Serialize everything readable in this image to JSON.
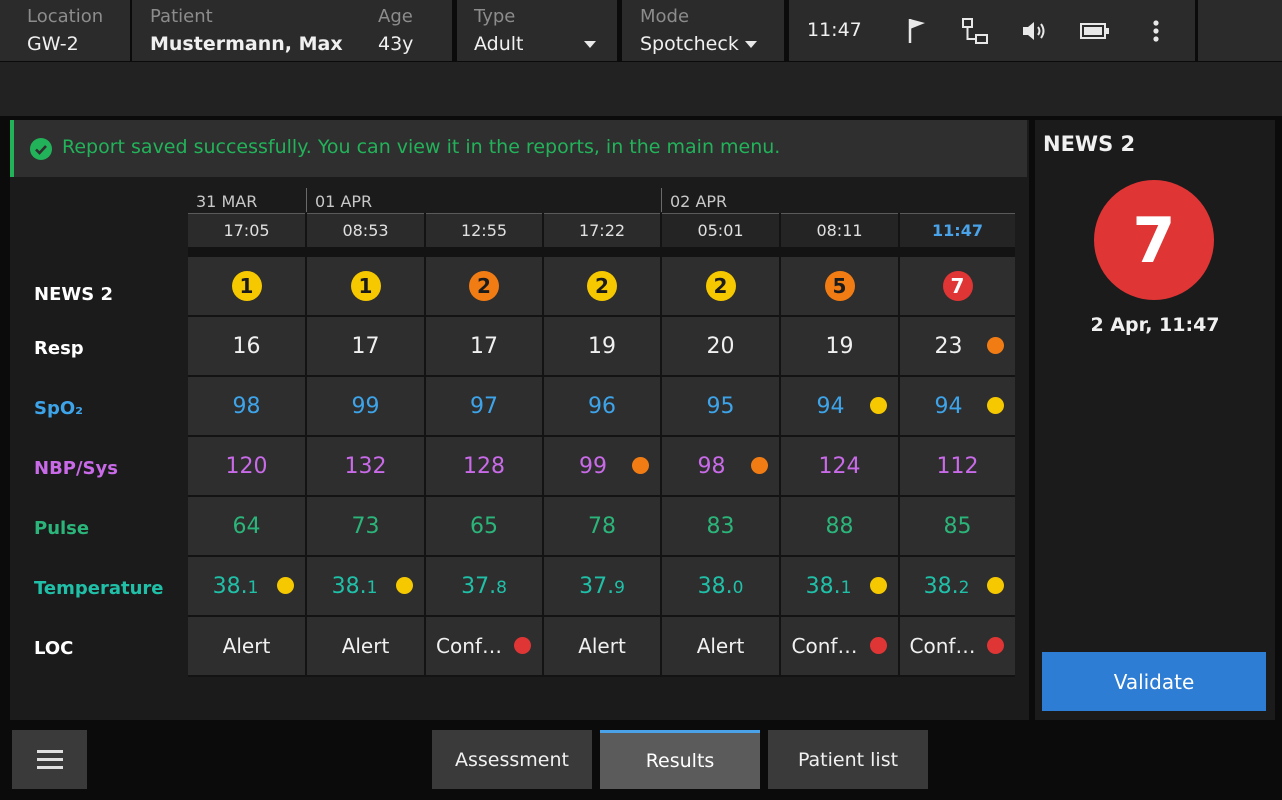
{
  "header": {
    "location_label": "Location",
    "location_value": "GW-2",
    "patient_label": "Patient",
    "patient_value": "Mustermann, Max",
    "age_label": "Age",
    "age_value": "43y",
    "type_label": "Type",
    "type_value": "Adult",
    "mode_label": "Mode",
    "mode_value": "Spotcheck",
    "time": "11:47",
    "status_icons": [
      "flag-icon",
      "network-icon",
      "speaker-icon",
      "battery-icon",
      "more-vertical-icon"
    ]
  },
  "toast": {
    "text": "Report saved successfully. You can view it in the reports, in the main menu.",
    "icon": "check-circle-icon"
  },
  "table": {
    "dates": [
      "31 MAR",
      "01 APR",
      "02 APR"
    ],
    "times": [
      "17:05",
      "08:53",
      "12:55",
      "17:22",
      "05:01",
      "08:11",
      "11:47"
    ],
    "row_labels": [
      "NEWS 2",
      "Resp",
      "SpO₂",
      "NBP/Sys",
      "Pulse",
      "Temperature",
      "LOC"
    ],
    "news2": [
      "1",
      "1",
      "2",
      "2",
      "2",
      "5",
      "7"
    ],
    "resp": [
      "16",
      "17",
      "17",
      "19",
      "20",
      "19",
      "23"
    ],
    "spo2": [
      "98",
      "99",
      "97",
      "96",
      "95",
      "94",
      "94"
    ],
    "nbp_sys": [
      "120",
      "132",
      "128",
      "99",
      "98",
      "124",
      "112"
    ],
    "pulse": [
      "64",
      "73",
      "65",
      "78",
      "83",
      "88",
      "85"
    ],
    "temperature_main": [
      "38.",
      "38.",
      "37.",
      "37.",
      "38.",
      "38.",
      "38."
    ],
    "temperature_sub": [
      "1",
      "1",
      "8",
      "9",
      "0",
      "1",
      "2"
    ],
    "loc": [
      "Alert",
      "Alert",
      "Conf…",
      "Alert",
      "Alert",
      "Conf…",
      "Conf…"
    ]
  },
  "side": {
    "title": "NEWS 2",
    "score": "7",
    "timestamp": "2 Apr, 11:47",
    "validate_label": "Validate"
  },
  "bottom": {
    "menu_icon": "hamburger-menu-icon",
    "tabs": [
      "Assessment",
      "Results",
      "Patient list"
    ],
    "active_tab": "Results"
  },
  "colors": {
    "score_yellow": "#f5c800",
    "score_orange": "#f27c14",
    "score_red": "#e03535",
    "accent_blue": "#4aa3e8",
    "spo2": "#3ea4ea",
    "nbp": "#c96ae8",
    "pulse": "#2bb57a",
    "temperature": "#20c0a8",
    "success_green": "#22b35a"
  }
}
